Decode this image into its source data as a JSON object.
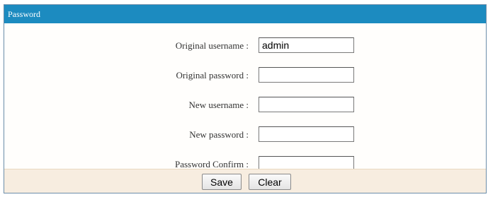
{
  "panel": {
    "title": "Password"
  },
  "fields": [
    {
      "label": "Original username :",
      "value": "admin"
    },
    {
      "label": "Original password :",
      "value": ""
    },
    {
      "label": "New username :",
      "value": ""
    },
    {
      "label": "New password :",
      "value": ""
    },
    {
      "label": "Password Confirm :",
      "value": ""
    }
  ],
  "buttons": {
    "save_label": "Save",
    "clear_label": "Clear"
  },
  "colors": {
    "header": "#1c8bc0",
    "footer": "#f7ede0"
  }
}
